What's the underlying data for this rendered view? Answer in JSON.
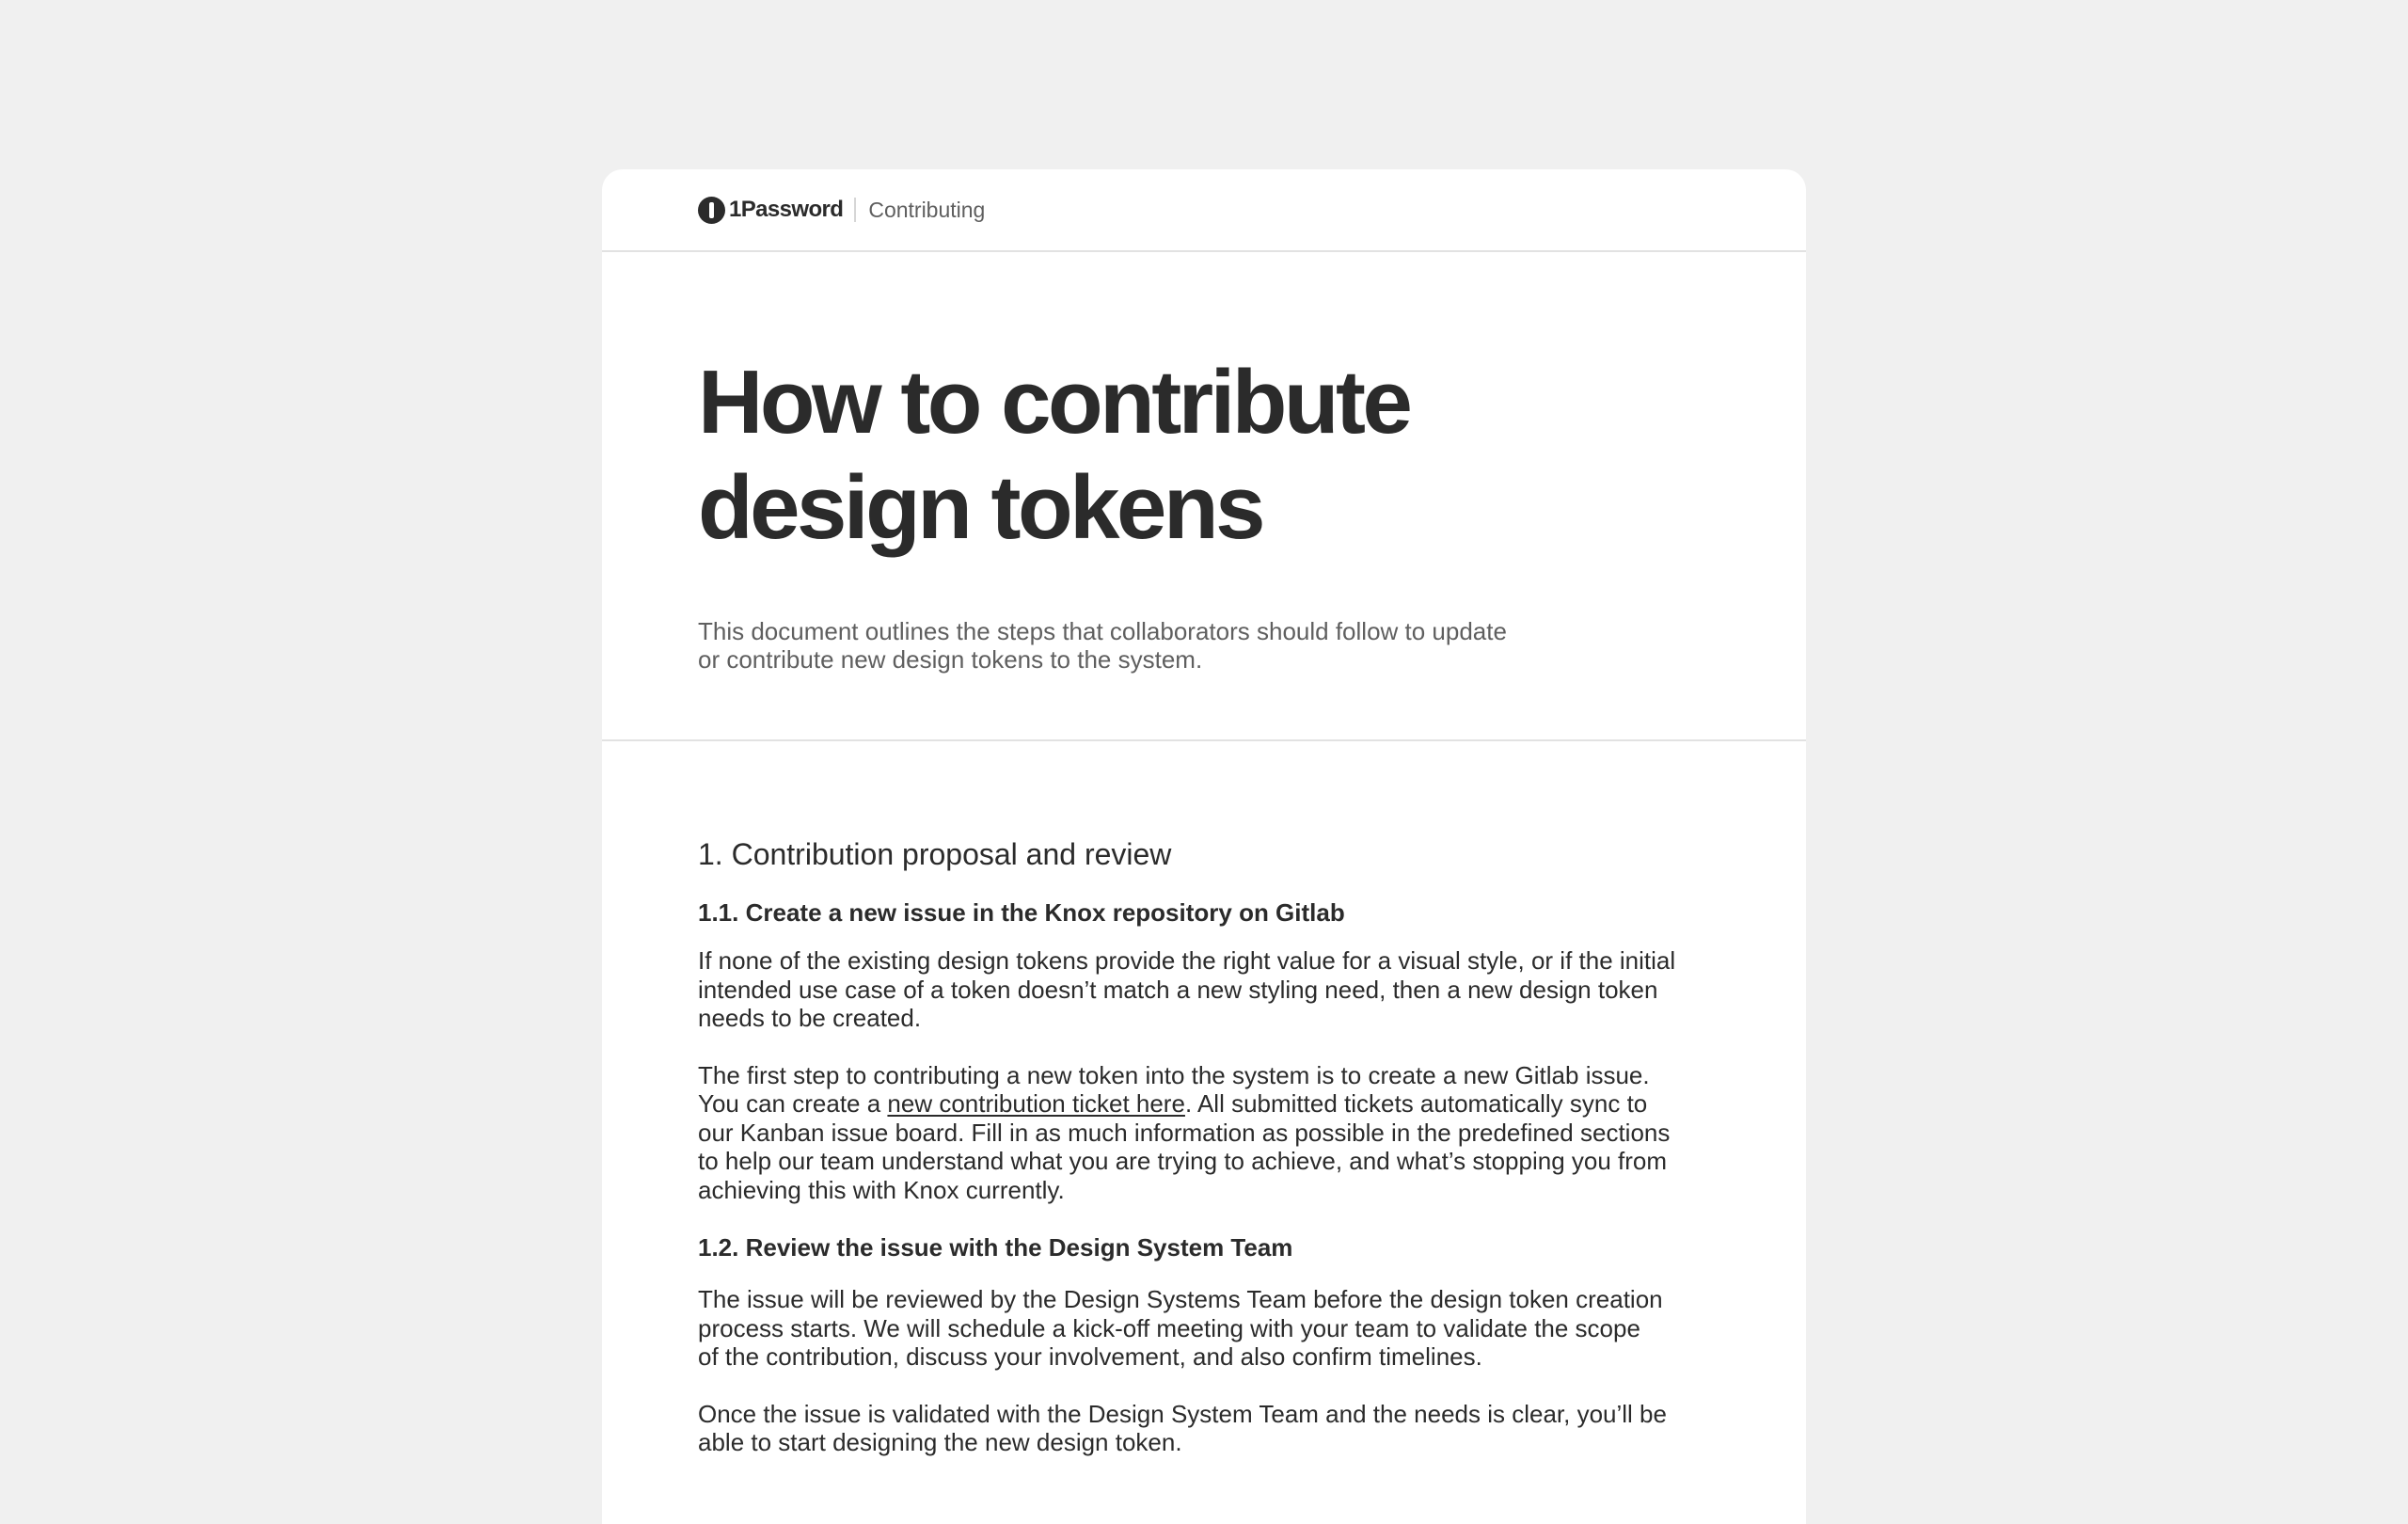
{
  "header": {
    "brand": "1Password",
    "section": "Contributing"
  },
  "hero": {
    "title_lines": [
      "How to contribute",
      "design tokens"
    ],
    "intro_lines": [
      "This document outlines the steps that collaborators should follow to update",
      "or contribute new design tokens to the system."
    ]
  },
  "content": {
    "section_title": "1. Contribution proposal and review",
    "sub1": {
      "title": "1.1. Create a new issue in the Knox repository on Gitlab",
      "para1_lines": [
        "If none of the existing design tokens provide the right value for a visual style, or if the initial",
        "intended use case of a token doesn’t match a new styling need, then a new design token",
        "needs to be created."
      ],
      "para2": {
        "line1": "The first step to contributing a new token into the system is to create a new Gitlab issue.",
        "line2_pre": "You can create a ",
        "link": "new contribution ticket here",
        "line2_post": ". All submitted tickets automatically sync to",
        "rest_lines": [
          "our Kanban issue board. Fill in as much information as possible in the predefined sections",
          "to help our team understand what you are trying to achieve, and what’s stopping you from",
          "achieving this with Knox currently."
        ]
      }
    },
    "sub2": {
      "title": "1.2. Review the issue with the Design System Team",
      "para1_lines": [
        "The issue will be reviewed by the Design Systems Team before the design token creation",
        "process starts. We will  schedule a kick-off meeting with your team to validate the scope",
        "of the contribution, discuss your involvement, and also confirm timelines."
      ],
      "para2_lines": [
        "Once the issue is validated with the Design System Team and the needs is clear, you’ll be",
        "able to start designing the new design token."
      ]
    }
  }
}
